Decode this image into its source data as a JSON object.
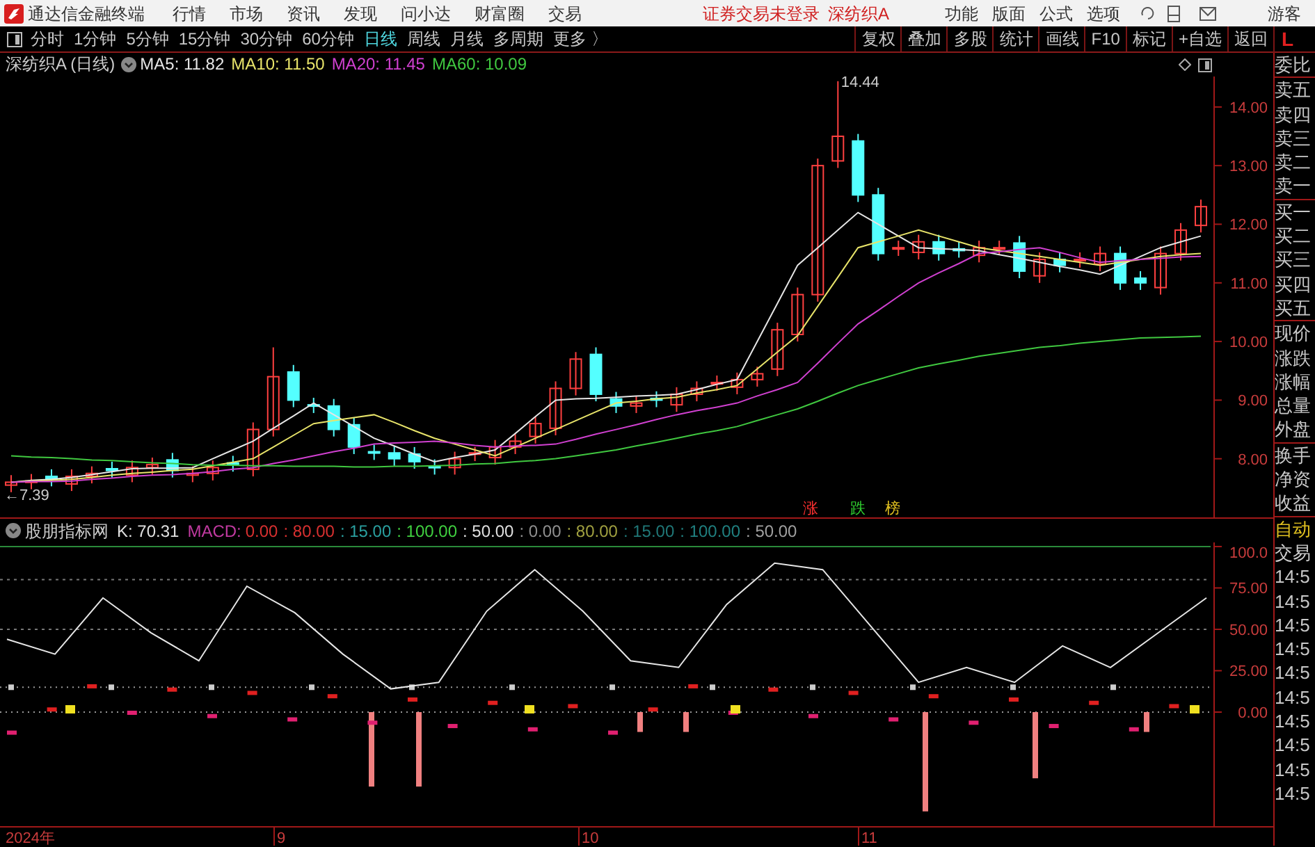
{
  "menu_bar": {
    "app_title": "通达信金融终端",
    "menus": [
      "行情",
      "市场",
      "资讯",
      "发现",
      "问小达",
      "财富圈",
      "交易"
    ],
    "notice": "证券交易未登录",
    "stock": "深纺织A",
    "tools": [
      "功能",
      "版面",
      "公式",
      "选项"
    ],
    "user": "游客"
  },
  "toolbar": {
    "periods": [
      {
        "label": "分时",
        "selected": false
      },
      {
        "label": "1分钟",
        "selected": false
      },
      {
        "label": "5分钟",
        "selected": false
      },
      {
        "label": "15分钟",
        "selected": false
      },
      {
        "label": "30分钟",
        "selected": false
      },
      {
        "label": "60分钟",
        "selected": false
      },
      {
        "label": "日线",
        "selected": true
      },
      {
        "label": "周线",
        "selected": false
      },
      {
        "label": "月线",
        "selected": false
      },
      {
        "label": "多周期",
        "selected": false
      }
    ],
    "more": "更多 〉",
    "actions": [
      "复权",
      "叠加",
      "多股",
      "统计",
      "画线",
      "F10",
      "标记",
      "+自选",
      "返回"
    ],
    "corner": "L"
  },
  "main_chart": {
    "title": "深纺织A (日线)",
    "indicators": [
      {
        "label": "MA5: 11.82",
        "color": "#e6e6e6"
      },
      {
        "label": "MA10: 11.50",
        "color": "#e8e46a"
      },
      {
        "label": "MA20: 11.45",
        "color": "#d040d0"
      },
      {
        "label": "MA60: 10.09",
        "color": "#40c840"
      }
    ],
    "high_label": "14.44",
    "low_label": "←7.39",
    "ranking_tabs": [
      {
        "label": "涨",
        "color": "#ff3030"
      },
      {
        "label": "跌",
        "color": "#30d030"
      },
      {
        "label": "榜",
        "color": "#e0c020"
      }
    ],
    "chart_data": {
      "type": "candlestick",
      "ylim": [
        7.0,
        14.52
      ],
      "yticks": [
        {
          "value": 8,
          "label": "8.00"
        },
        {
          "value": 9,
          "label": "9.00"
        },
        {
          "value": 10,
          "label": "10.00"
        },
        {
          "value": 11,
          "label": "11.00"
        },
        {
          "value": 12,
          "label": "12.00"
        },
        {
          "value": 13,
          "label": "13.00"
        },
        {
          "value": 14,
          "label": "14.00"
        }
      ],
      "ohlc": [
        [
          7.55,
          7.72,
          7.43,
          7.6
        ],
        [
          7.6,
          7.74,
          7.48,
          7.62
        ],
        [
          7.7,
          7.82,
          7.53,
          7.65
        ],
        [
          7.57,
          7.82,
          7.45,
          7.7
        ],
        [
          7.7,
          7.87,
          7.58,
          7.75
        ],
        [
          7.83,
          7.95,
          7.68,
          7.8
        ],
        [
          7.72,
          7.97,
          7.6,
          7.85
        ],
        [
          7.85,
          8.02,
          7.73,
          7.9
        ],
        [
          7.98,
          8.1,
          7.68,
          7.8
        ],
        [
          7.72,
          7.87,
          7.6,
          7.75
        ],
        [
          7.75,
          7.97,
          7.63,
          7.85
        ],
        [
          7.93,
          8.05,
          7.78,
          7.9
        ],
        [
          7.82,
          8.62,
          7.7,
          8.5
        ],
        [
          8.5,
          9.9,
          8.38,
          9.4
        ],
        [
          9.48,
          9.6,
          8.88,
          9.0
        ],
        [
          8.92,
          9.04,
          8.78,
          8.9
        ],
        [
          8.9,
          9.02,
          8.38,
          8.5
        ],
        [
          8.58,
          8.7,
          8.08,
          8.2
        ],
        [
          8.12,
          8.24,
          7.98,
          8.1
        ],
        [
          8.1,
          8.22,
          7.88,
          8.0
        ],
        [
          8.08,
          8.2,
          7.83,
          7.95
        ],
        [
          7.87,
          7.99,
          7.73,
          7.85
        ],
        [
          7.85,
          8.12,
          7.73,
          8.0
        ],
        [
          8.08,
          8.2,
          7.96,
          8.1
        ],
        [
          8.02,
          8.32,
          7.9,
          8.2
        ],
        [
          8.2,
          8.42,
          8.08,
          8.3
        ],
        [
          8.38,
          8.72,
          8.26,
          8.6
        ],
        [
          8.52,
          9.32,
          8.4,
          9.2
        ],
        [
          9.2,
          9.82,
          9.08,
          9.7
        ],
        [
          9.78,
          9.9,
          8.98,
          9.1
        ],
        [
          9.02,
          9.14,
          8.78,
          8.9
        ],
        [
          8.9,
          9.07,
          8.78,
          8.95
        ],
        [
          9.03,
          9.15,
          8.88,
          9.0
        ],
        [
          8.92,
          9.22,
          8.8,
          9.1
        ],
        [
          9.1,
          9.32,
          8.98,
          9.2
        ],
        [
          9.28,
          9.42,
          9.16,
          9.3
        ],
        [
          9.22,
          9.47,
          9.1,
          9.35
        ],
        [
          9.35,
          9.57,
          9.23,
          9.45
        ],
        [
          9.53,
          10.32,
          9.41,
          10.2
        ],
        [
          10.12,
          10.92,
          10.0,
          10.8
        ],
        [
          10.8,
          13.12,
          10.68,
          13.0
        ],
        [
          13.08,
          14.44,
          12.96,
          13.5
        ],
        [
          13.42,
          13.54,
          12.38,
          12.5
        ],
        [
          12.5,
          12.62,
          11.38,
          11.5
        ],
        [
          11.58,
          11.72,
          11.46,
          11.6
        ],
        [
          11.52,
          11.82,
          11.4,
          11.7
        ],
        [
          11.7,
          11.82,
          11.38,
          11.5
        ],
        [
          11.58,
          11.7,
          11.43,
          11.55
        ],
        [
          11.47,
          11.72,
          11.35,
          11.6
        ],
        [
          11.6,
          11.72,
          11.48,
          11.6
        ],
        [
          11.68,
          11.8,
          11.08,
          11.2
        ],
        [
          11.12,
          11.52,
          11.0,
          11.4
        ],
        [
          11.4,
          11.52,
          11.18,
          11.3
        ],
        [
          11.38,
          11.52,
          11.26,
          11.4
        ],
        [
          11.32,
          11.62,
          11.2,
          11.5
        ],
        [
          11.5,
          11.62,
          10.88,
          11.0
        ],
        [
          11.08,
          11.2,
          10.88,
          11.0
        ],
        [
          10.92,
          11.62,
          10.8,
          11.5
        ],
        [
          11.5,
          12.02,
          11.38,
          11.9
        ],
        [
          11.98,
          12.42,
          11.86,
          12.3
        ]
      ]
    },
    "moving_averages": {
      "chart_data": {
        "type": "line",
        "ylim": [
          7.0,
          14.52
        ],
        "series": [
          {
            "color": "#e6e6e6",
            "values": [
              7.6,
              7.63,
              7.65,
              7.68,
              7.73,
              7.78,
              7.83,
              7.84,
              7.84,
              7.85,
              8.0,
              8.15,
              8.3,
              8.52,
              8.73,
              8.95,
              8.75,
              8.55,
              8.35,
              8.22,
              8.08,
              7.95,
              8.02,
              8.08,
              8.15,
              8.43,
              8.72,
              9.0,
              9.02,
              9.03,
              9.05,
              9.07,
              9.08,
              9.1,
              9.18,
              9.27,
              9.35,
              10.0,
              10.65,
              11.3,
              11.6,
              11.9,
              12.2,
              12.0,
              11.8,
              11.6,
              11.58,
              11.57,
              11.55,
              11.48,
              11.42,
              11.35,
              11.28,
              11.22,
              11.15,
              11.3,
              11.45,
              11.6,
              11.7,
              11.8
            ]
          },
          {
            "color": "#e8e46a",
            "values": [
              7.6,
              7.62,
              7.63,
              7.65,
              7.68,
              7.72,
              7.75,
              7.77,
              7.8,
              7.82,
              7.88,
              7.94,
              8.0,
              8.2,
              8.4,
              8.6,
              8.65,
              8.7,
              8.75,
              8.62,
              8.48,
              8.35,
              8.25,
              8.15,
              8.05,
              8.2,
              8.35,
              8.5,
              8.65,
              8.8,
              8.95,
              8.98,
              9.02,
              9.05,
              9.12,
              9.18,
              9.25,
              9.53,
              9.82,
              10.1,
              10.6,
              11.1,
              11.6,
              11.7,
              11.8,
              11.9,
              11.8,
              11.7,
              11.6,
              11.55,
              11.5,
              11.45,
              11.4,
              11.35,
              11.3,
              11.35,
              11.4,
              11.45,
              11.48,
              11.5
            ]
          },
          {
            "color": "#d040d0",
            "values": [
              7.6,
              7.61,
              7.61,
              7.62,
              7.65,
              7.67,
              7.7,
              7.72,
              7.73,
              7.75,
              7.78,
              7.82,
              7.85,
              7.92,
              7.98,
              8.05,
              8.12,
              8.18,
              8.25,
              8.27,
              8.28,
              8.3,
              8.27,
              8.23,
              8.2,
              8.22,
              8.23,
              8.25,
              8.33,
              8.42,
              8.5,
              8.58,
              8.67,
              8.75,
              8.82,
              8.88,
              8.95,
              9.07,
              9.18,
              9.3,
              9.63,
              9.97,
              10.3,
              10.53,
              10.77,
              11.0,
              11.17,
              11.33,
              11.5,
              11.53,
              11.57,
              11.6,
              11.52,
              11.43,
              11.35,
              11.38,
              11.4,
              11.42,
              11.44,
              11.45
            ]
          },
          {
            "color": "#40c840",
            "values": [
              8.05,
              8.03,
              8.02,
              8.0,
              7.98,
              7.97,
              7.95,
              7.93,
              7.92,
              7.9,
              7.89,
              7.89,
              7.88,
              7.88,
              7.87,
              7.87,
              7.87,
              7.86,
              7.86,
              7.87,
              7.87,
              7.88,
              7.89,
              7.91,
              7.92,
              7.95,
              7.97,
              8.0,
              8.05,
              8.1,
              8.15,
              8.22,
              8.28,
              8.35,
              8.42,
              8.48,
              8.55,
              8.65,
              8.75,
              8.85,
              8.98,
              9.12,
              9.25,
              9.35,
              9.45,
              9.55,
              9.62,
              9.68,
              9.75,
              9.8,
              9.85,
              9.9,
              9.93,
              9.97,
              10.0,
              10.03,
              10.06,
              10.07,
              10.08,
              10.09
            ]
          }
        ]
      }
    }
  },
  "indicator_panel": {
    "name": "股朋指标网",
    "k_reading": "K: 70.31",
    "macd_label": {
      "text": "MACD:",
      "color": "#c03aa0"
    },
    "macd_parts": [
      {
        "text": "0.00",
        "color": "#d83030"
      },
      {
        "text": ": 80.00",
        "color": "#d83030"
      },
      {
        "text": ": 15.00",
        "color": "#2aa0a0"
      },
      {
        "text": ": 100.00",
        "color": "#40d040"
      },
      {
        "text": ": 50.00",
        "color": "#e0e0e0"
      },
      {
        "text": ": 0.00",
        "color": "#909090"
      },
      {
        "text": ": 80.00",
        "color": "#a0a040"
      },
      {
        "text": ": 15.00",
        "color": "#207878"
      },
      {
        "text": ": 100.00",
        "color": "#208080"
      },
      {
        "text": ": 50.00",
        "color": "#a0a0a0"
      }
    ],
    "chart_data": {
      "type": "line",
      "ylim": [
        -68.9,
        102.5
      ],
      "yticks": [
        {
          "value": 0,
          "label": "0.00"
        },
        {
          "value": 25,
          "label": "25.00"
        },
        {
          "value": 50,
          "label": "50.00"
        },
        {
          "value": 75,
          "label": "75.00"
        },
        {
          "value": 100,
          "label": "100.0"
        }
      ],
      "series": [
        {
          "color": "#e6e6e6",
          "values": [
            44,
            35,
            69,
            48,
            31,
            76,
            60,
            35,
            14,
            18,
            61,
            86,
            61,
            31,
            27,
            65,
            90,
            86,
            52,
            18,
            27,
            18,
            40,
            27,
            48,
            69
          ]
        }
      ]
    }
  },
  "date_axis": [
    "2024年",
    "9",
    "10",
    "11"
  ],
  "side_panel": {
    "groups": [
      [
        "委比"
      ],
      [
        "卖五",
        "卖四",
        "卖三",
        "卖二",
        "卖一"
      ],
      [
        "买一",
        "买二",
        "买三",
        "买四",
        "买五"
      ],
      [
        "现价",
        "涨跌",
        "涨幅",
        "总量",
        "外盘"
      ],
      [
        "换手",
        "净资",
        "收益"
      ]
    ],
    "trade_labels": [
      {
        "text": "自动",
        "color": "#e0c020"
      },
      {
        "text": "交易",
        "color": "#d0d0d0"
      }
    ],
    "times": [
      "14:5",
      "14:5",
      "14:5",
      "14:5",
      "14:5",
      "14:5",
      "14:5",
      "14:5",
      "14:5",
      "14:5"
    ]
  }
}
